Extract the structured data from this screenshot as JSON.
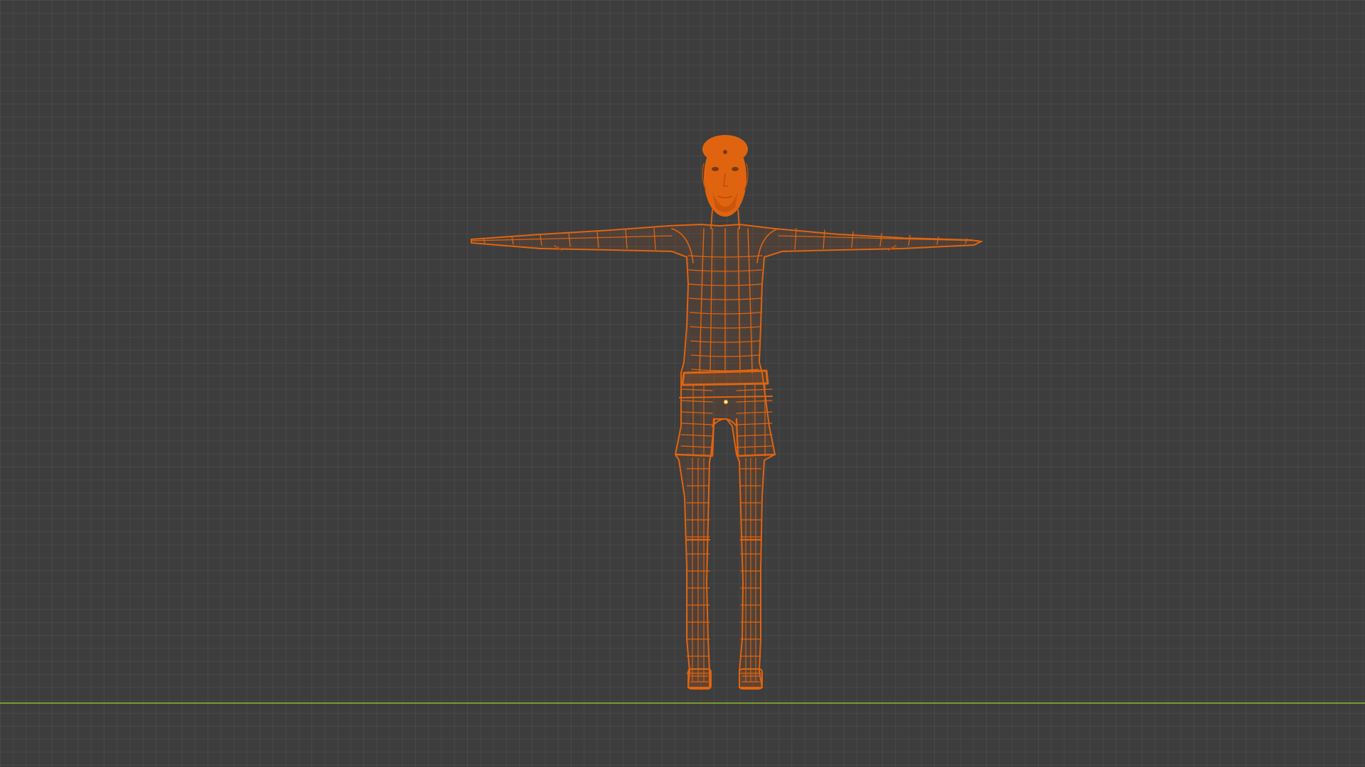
{
  "viewport": {
    "background_color": "#3d3d3d",
    "grid_color": "#4a4a4a",
    "x_axis_color": "#7a9a2e",
    "selection_color": "#e06410",
    "selection_dark_color": "#b94e08"
  },
  "scene": {
    "object": "humanoid-mesh",
    "display_mode": "wireframe",
    "pose": "T-pose",
    "selected": true
  }
}
